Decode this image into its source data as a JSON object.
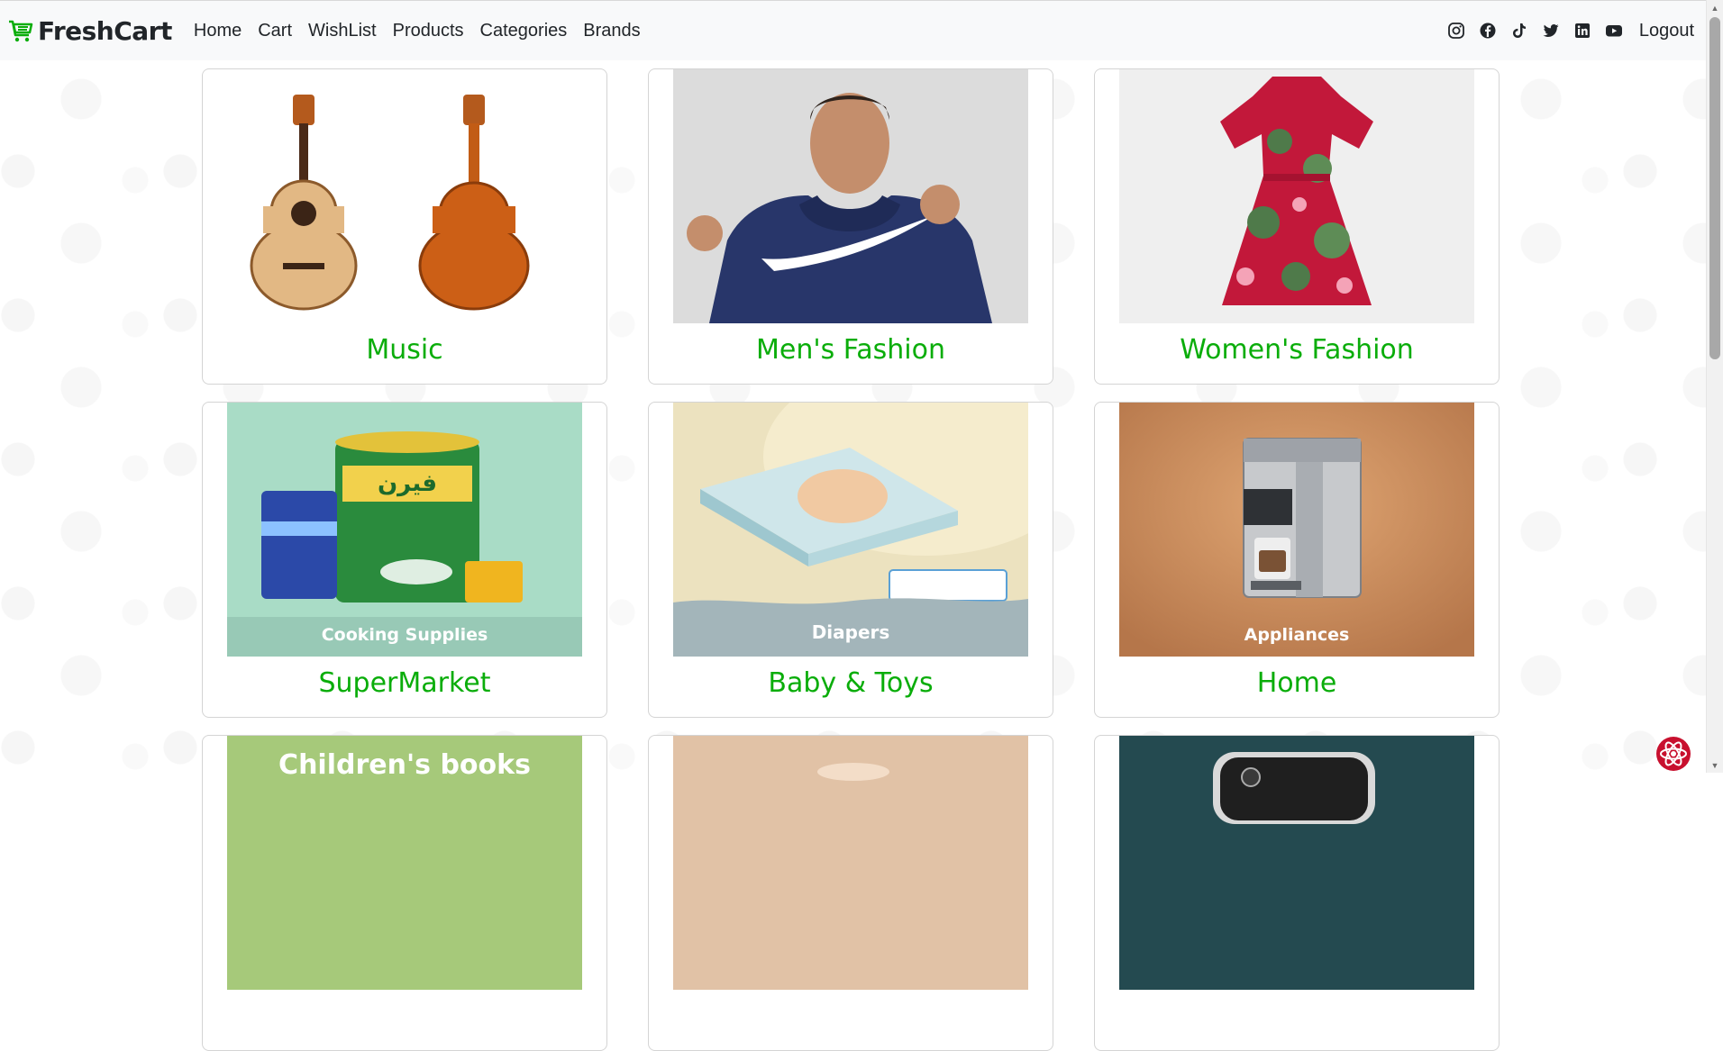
{
  "brand": {
    "name": "FreshCart",
    "icon": "cart-icon",
    "color": "#0aad0a"
  },
  "nav": {
    "links": [
      "Home",
      "Cart",
      "WishList",
      "Products",
      "Categories",
      "Brands"
    ],
    "social_icons": [
      "instagram-icon",
      "facebook-icon",
      "tiktok-icon",
      "twitter-icon",
      "linkedin-icon",
      "youtube-icon"
    ],
    "logout": "Logout"
  },
  "categories": [
    {
      "name": "Music",
      "image": "guitar-image"
    },
    {
      "name": "Men's Fashion",
      "image": "hoodie-image"
    },
    {
      "name": "Women's Fashion",
      "image": "dress-image"
    },
    {
      "name": "SuperMarket",
      "image": "groceries-image",
      "caption": "Cooking Supplies"
    },
    {
      "name": "Baby & Toys",
      "image": "diapers-image",
      "caption": "Diapers"
    },
    {
      "name": "Home",
      "image": "coffee-machine-image",
      "caption": "Appliances"
    },
    {
      "name": "",
      "image": "books-image",
      "caption": "Children's books"
    },
    {
      "name": "",
      "image": "beauty-image"
    },
    {
      "name": "",
      "image": "phone-image"
    }
  ],
  "colors": {
    "accent": "#0aad0a",
    "navbar_bg": "#f8f9fa",
    "text": "#212529"
  }
}
